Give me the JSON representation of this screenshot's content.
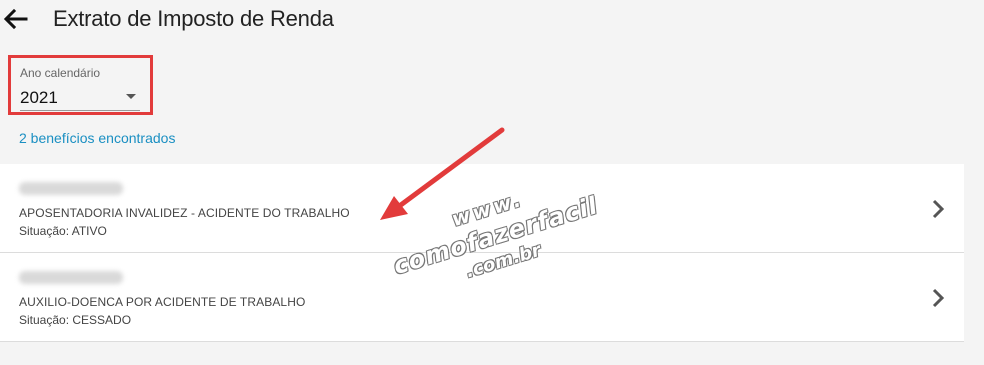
{
  "header": {
    "back_icon": "arrow-left-icon",
    "title": "Extrato de Imposto de Renda"
  },
  "year_filter": {
    "label": "Ano calendário",
    "selected": "2021",
    "highlight_color": "#e23b3b"
  },
  "results": {
    "count_text": "2 benefícios encontrados",
    "count_color": "#1a8fc2"
  },
  "benefits": [
    {
      "title": "APOSENTADORIA INVALIDEZ - ACIDENTE DO TRABALHO",
      "status": "Situação: ATIVO"
    },
    {
      "title": "AUXILIO-DOENCA POR ACIDENTE DE TRABALHO",
      "status": "Situação: CESSADO"
    }
  ],
  "annotation": {
    "arrow_color": "#e23b3b"
  },
  "watermark": {
    "line1": "www.",
    "line2": "comofazerfacil",
    "line3": ".com.br"
  }
}
